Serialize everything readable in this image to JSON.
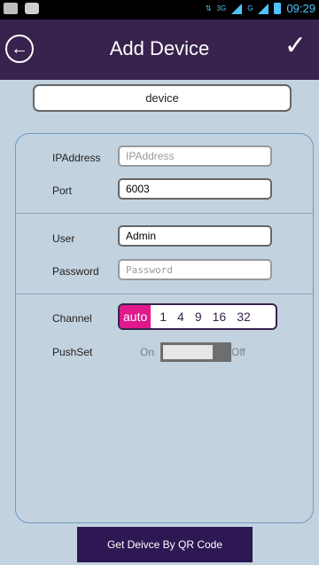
{
  "status": {
    "time": "09:29",
    "network_label": "3G"
  },
  "header": {
    "title": "Add Device"
  },
  "device_name": {
    "value": "device"
  },
  "fields": {
    "ip": {
      "label": "IPAddress",
      "placeholder": "IPAddress"
    },
    "port": {
      "label": "Port",
      "value": "6003"
    },
    "user": {
      "label": "User",
      "value": "Admin"
    },
    "password": {
      "label": "Password",
      "placeholder": "Password"
    }
  },
  "channel": {
    "label": "Channel",
    "options": [
      "auto",
      "1",
      "4",
      "9",
      "16",
      "32"
    ],
    "selected": "auto",
    "accent": "#e0188c"
  },
  "push": {
    "label": "PushSet",
    "on_label": "On",
    "off_label": "Off",
    "state": "off"
  },
  "qr_button": {
    "label": "Get Deivce By QR Code"
  },
  "colors": {
    "header_bg": "#38234e",
    "panel_bg": "#c3d2df",
    "button_bg": "#2d1854"
  }
}
